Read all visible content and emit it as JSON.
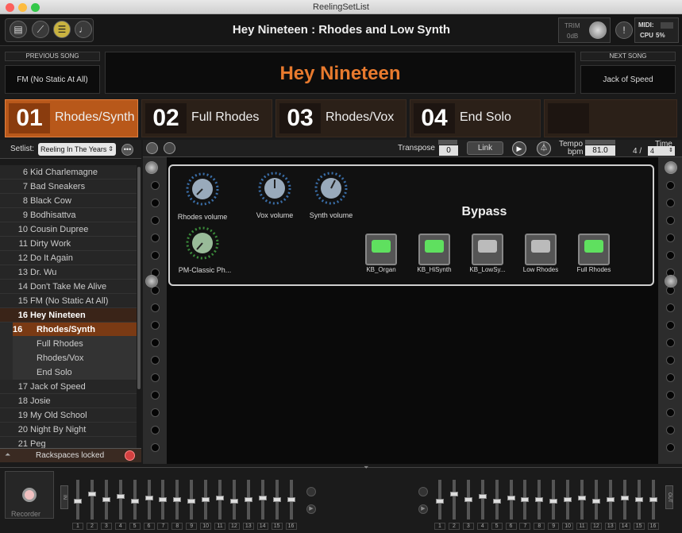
{
  "window": {
    "title": "ReelingSetList"
  },
  "header": {
    "song_title": "Hey Nineteen : Rhodes and Low Synth",
    "trim_label": "TRIM",
    "trim_value": "0dB",
    "midi_label": "MIDI:",
    "cpu_label": "CPU",
    "cpu_value": "5%"
  },
  "songs": {
    "previous_label": "PREVIOUS SONG",
    "previous_name": "FM (No Static At All)",
    "current_name": "Hey Nineteen",
    "next_label": "NEXT SONG",
    "next_name": "Jack of Speed"
  },
  "parts": [
    {
      "num": "01",
      "label": "Rhodes/Synth"
    },
    {
      "num": "02",
      "label": "Full Rhodes"
    },
    {
      "num": "03",
      "label": "Rhodes/Vox"
    },
    {
      "num": "04",
      "label": "End Solo"
    }
  ],
  "setlist": {
    "label": "Setlist:",
    "selected": "Reeling In The Years",
    "items": [
      {
        "n": "6",
        "name": "Kid Charlemagne"
      },
      {
        "n": "7",
        "name": "Bad Sneakers"
      },
      {
        "n": "8",
        "name": "Black Cow"
      },
      {
        "n": "9",
        "name": "Bodhisattva"
      },
      {
        "n": "10",
        "name": "Cousin Dupree"
      },
      {
        "n": "11",
        "name": "Dirty Work"
      },
      {
        "n": "12",
        "name": "Do It Again"
      },
      {
        "n": "13",
        "name": "Dr. Wu"
      },
      {
        "n": "14",
        "name": "Don't Take Me Alive"
      },
      {
        "n": "15",
        "name": "FM (No Static At All)"
      },
      {
        "n": "16",
        "name": "Hey Nineteen"
      },
      {
        "n": "16",
        "name": "Rhodes/Synth"
      },
      {
        "n": "",
        "name": "Full Rhodes"
      },
      {
        "n": "",
        "name": "Rhodes/Vox"
      },
      {
        "n": "",
        "name": "End Solo"
      },
      {
        "n": "17",
        "name": "Jack of Speed"
      },
      {
        "n": "18",
        "name": "Josie"
      },
      {
        "n": "19",
        "name": "My Old School"
      },
      {
        "n": "20",
        "name": "Night By Night"
      },
      {
        "n": "21",
        "name": "Peg"
      }
    ],
    "locked_label": "Rackspaces locked"
  },
  "transport": {
    "transpose_label": "Transpose",
    "transpose_value": "0",
    "link_label": "Link",
    "tempo_label": "Tempo",
    "bpm_label": "bpm",
    "bpm_value": "81.0",
    "time_label": "Time",
    "time_num": "4 /",
    "time_den": "4"
  },
  "panel": {
    "knobs": [
      {
        "label": "Rhodes volume",
        "ring": "#3a6ea8"
      },
      {
        "label": "Vox volume",
        "ring": "#3a6ea8"
      },
      {
        "label": "Synth volume",
        "ring": "#3a6ea8"
      },
      {
        "label": "PM-Classic Ph...",
        "ring": "#3a8a3a"
      }
    ],
    "bypass_title": "Bypass",
    "switches": [
      {
        "label": "KB_Organ",
        "on": true
      },
      {
        "label": "KB_HiSynth",
        "on": true
      },
      {
        "label": "KB_LowSy...",
        "on": false
      },
      {
        "label": "Low Rhodes",
        "on": false
      },
      {
        "label": "Full Rhodes",
        "on": true
      }
    ]
  },
  "mixer": {
    "recorder_label": "Recorder",
    "in_label": "IN",
    "out_label": "OUT",
    "channels": [
      "1",
      "2",
      "3",
      "4",
      "5",
      "6",
      "7",
      "8",
      "9",
      "10",
      "11",
      "12",
      "13",
      "14",
      "15",
      "16"
    ]
  },
  "colors": {
    "accent": "#e87a2e",
    "active_part": "#b8581a",
    "led_on": "#5fe05f"
  }
}
